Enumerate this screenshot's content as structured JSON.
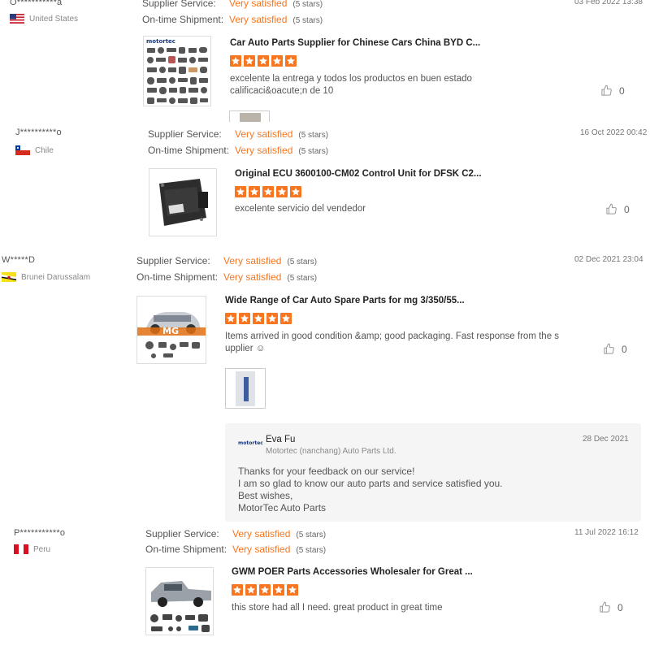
{
  "reviews": [
    {
      "buyer": "O***********a",
      "country": "United States",
      "supplier_service_label": "Supplier Service:",
      "supplier_service_value": "Very satisfied",
      "supplier_service_stars": "(5 stars)",
      "shipment_label": "On-time Shipment:",
      "shipment_value": "Very satisfied",
      "shipment_stars": "(5 stars)",
      "date": "03 Feb 2022 13:38",
      "product_title": "Car Auto Parts Supplier for Chinese Cars China BYD C...",
      "thumb_brand": "motortec",
      "text_lines": [
        "excelente la entrega y todos los productos en buen estado",
        "calificaci&oacute;n de 10"
      ],
      "likes": "0"
    },
    {
      "buyer": "J**********o",
      "country": "Chile",
      "supplier_service_label": "Supplier Service:",
      "supplier_service_value": "Very satisfied",
      "supplier_service_stars": "(5 stars)",
      "shipment_label": "On-time Shipment:",
      "shipment_value": "Very satisfied",
      "shipment_stars": "(5 stars)",
      "date": "16 Oct 2022 00:42",
      "product_title": "Original ECU 3600100-CM02 Control Unit for DFSK C2...",
      "text_lines": [
        "excelente servicio del vendedor"
      ],
      "likes": "0"
    },
    {
      "buyer": "W*****D",
      "country": "Brunei Darussalam",
      "supplier_service_label": "Supplier Service:",
      "supplier_service_value": "Very satisfied",
      "supplier_service_stars": "(5 stars)",
      "shipment_label": "On-time Shipment:",
      "shipment_value": "Very satisfied",
      "shipment_stars": "(5 stars)",
      "date": "02 Dec 2021 23:04",
      "product_title": "Wide Range of Car Auto Spare Parts for mg 3/350/55...",
      "thumb_brand": "MG",
      "text_lines": [
        "Items arrived in good condition &amp; good packaging. Fast response from the s",
        "upplier ☺"
      ],
      "likes": "0",
      "reply": {
        "logo": "motortec",
        "name": "Eva Fu",
        "company": "Motortec (nanchang) Auto Parts Ltd.",
        "date": "28 Dec 2021",
        "lines": [
          "Thanks for your feedback on our service!",
          "I am so glad to know our auto parts and service satisfied you.",
          "Best wishes,",
          "MotorTec Auto Parts"
        ]
      }
    },
    {
      "buyer": "P***********o",
      "country": "Peru",
      "supplier_service_label": "Supplier Service:",
      "supplier_service_value": "Very satisfied",
      "supplier_service_stars": "(5 stars)",
      "shipment_label": "On-time Shipment:",
      "shipment_value": "Very satisfied",
      "shipment_stars": "(5 stars)",
      "date": "11 Jul 2022 16:12",
      "product_title": "GWM POER Parts Accessories Wholesaler for Great ...",
      "text_lines": [
        "this store had all I need. great product in great time"
      ],
      "likes": "0"
    }
  ],
  "colors": {
    "accent": "#f7761f",
    "reply_bg": "#f5f5f5"
  },
  "icons": {
    "like": "thumbs-up-icon",
    "star": "star-icon"
  }
}
